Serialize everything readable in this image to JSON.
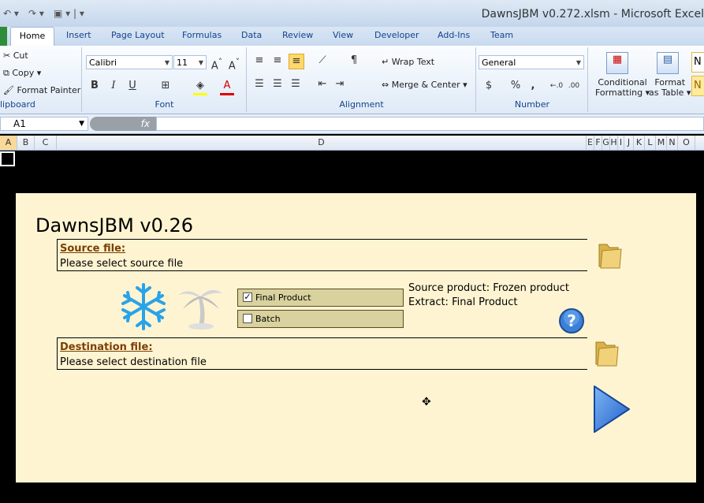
{
  "window": {
    "title": "DawnsJBM v0.272.xlsm - Microsoft Excel"
  },
  "tabs": [
    "Home",
    "Insert",
    "Page Layout",
    "Formulas",
    "Data",
    "Review",
    "View",
    "Developer",
    "Add-Ins",
    "Team"
  ],
  "clipboard": {
    "cut": "Cut",
    "copy": "Copy",
    "format_painter": "Format Painter",
    "label": "lipboard"
  },
  "font": {
    "name": "Calibri",
    "size": "11",
    "label": "Font",
    "bold": "B",
    "italic": "I",
    "underline": "U"
  },
  "alignment": {
    "wrap_text": "Wrap Text",
    "merge_center": "Merge & Center",
    "label": "Alignment"
  },
  "number": {
    "format": "General",
    "currency": "$",
    "percent": "%",
    "comma": ",",
    "label": "Number"
  },
  "styles": {
    "conditional": "Conditional",
    "formatting": "Formatting",
    "format": "Format",
    "as_table": "as Table",
    "cell_style": "N"
  },
  "formula_bar": {
    "name_box": "A1",
    "fx": "fx",
    "formula": ""
  },
  "columns": [
    "A",
    "B",
    "C",
    "D",
    "E",
    "F",
    "G",
    "H",
    "I",
    "J",
    "K",
    "L",
    "M",
    "N",
    "O"
  ],
  "form": {
    "title": "DawnsJBM v0.26",
    "source_label": "Source file:",
    "source_value": "Please select source file",
    "final_product_label": "Final Product",
    "final_product_checked": true,
    "batch_label": "Batch",
    "batch_checked": false,
    "source_product": "Source product: Frozen product",
    "extract": "Extract: Final Product",
    "dest_label": "Destination file:",
    "dest_value": "Please select destination file"
  },
  "colors": {
    "form_bg": "#fff4d2",
    "checkbox_bg": "#d9d29e",
    "label_brown": "#7b3f00",
    "accent_blue": "#1f6fd6"
  }
}
